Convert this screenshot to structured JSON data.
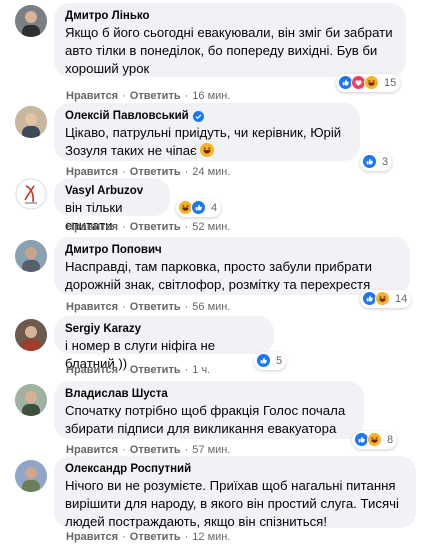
{
  "comments": [
    {
      "author": "Дмитро Лінько",
      "text": "Якщо б його сьогодні евакуювали, він зміг би забрати авто тілки в понеділок, бо попереду вихідні. Був би хороший урок",
      "like_label": "Нравится",
      "reply_label": "Ответить",
      "time": "16 мин.",
      "reaction_icons": [
        "like-icon",
        "love-icon",
        "haha-icon"
      ],
      "reaction_count": "15"
    },
    {
      "author": "Олексій Павловський",
      "verified": true,
      "text": "Цікаво, патрульні приідуть, чи керівник, Юрій Зозуля таких не чіпає",
      "like_label": "Нравится",
      "reply_label": "Ответить",
      "time": "24 мин.",
      "reaction_icons": [
        "like-icon"
      ],
      "reaction_count": "3"
    },
    {
      "author": "Vasyl Arbuzov",
      "text": "він тільки спитати",
      "like_label": "Нравится",
      "reply_label": "Ответить",
      "time": "52 мин.",
      "reaction_icons": [
        "haha-icon",
        "like-icon"
      ],
      "reaction_count": "4"
    },
    {
      "author": "Дмитро Попович",
      "text": "Насправді, там парковка, просто забули прибрати дорожній знак, світлофор, розмітку та перехрестя",
      "like_label": "Нравится",
      "reply_label": "Ответить",
      "time": "56 мин.",
      "reaction_icons": [
        "like-icon",
        "haha-icon"
      ],
      "reaction_count": "14"
    },
    {
      "author": "Sergiy Karazy",
      "text": "і номер в слуги ніфіга не блатний ))",
      "like_label": "Нравится",
      "reply_label": "Ответить",
      "time": "1 ч.",
      "reaction_icons": [
        "like-icon"
      ],
      "reaction_count": "5"
    },
    {
      "author": "Владислав Шуста",
      "text": "Спочатку потрібно щоб фракція Голос почала збирати підписи для викликання евакуатора",
      "like_label": "Нравится",
      "reply_label": "Ответить",
      "time": "57 мин.",
      "reaction_icons": [
        "like-icon",
        "haha-icon"
      ],
      "reaction_count": "8"
    },
    {
      "author": "Олександр Роспутний",
      "text": "Нічого ви не розумієте. Приїхав щоб нагальні питання вирішити для народу, в якого він простий слуга. Тисячі людей постраждають, якщо він спізниться!",
      "like_label": "Нравится",
      "reply_label": "Ответить",
      "time": "12 мин.",
      "reaction_icons": [],
      "reaction_count": ""
    }
  ],
  "colors": {
    "bubble": "#f0f2f5",
    "meta": "#65676b",
    "like": "#1877f2",
    "love": "#f33e58",
    "haha": "#f7b125"
  }
}
